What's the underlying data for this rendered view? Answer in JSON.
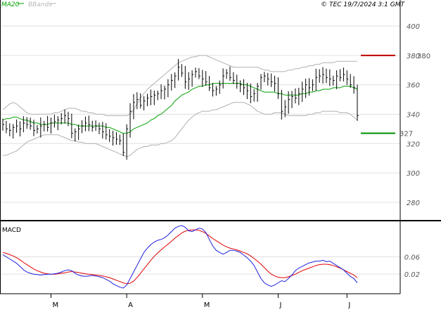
{
  "header": {
    "copyright": "© TEC 19/7/2024 3:1 GMT",
    "legend": [
      {
        "label": "MA20",
        "color": "#00a000"
      },
      {
        "label": "BBands",
        "color": "#b8b8b8"
      }
    ]
  },
  "panels": {
    "macd_label": "MACD"
  },
  "colors": {
    "price_bars": "#000000",
    "ma20": "#00a000",
    "bbands": "#b0b0b0",
    "resistance": "#c00000",
    "support": "#009000",
    "macd_line": "#2020e0",
    "signal_line": "#e00000",
    "grid": "#e0e0e0",
    "frame": "#000000"
  },
  "chart_data": [
    {
      "type": "ohlc",
      "ylim": [
        268,
        412
      ],
      "ytick_labels": [
        "400",
        "380",
        "360",
        "340",
        "320",
        "300",
        "280"
      ],
      "yticks": [
        400,
        380,
        360,
        340,
        320,
        300,
        280
      ],
      "xtick_labels": [
        "M",
        "A",
        "M",
        "J",
        "J"
      ],
      "xtick_index": [
        14,
        36,
        58,
        80,
        100
      ],
      "levels": [
        {
          "name": "resistance",
          "value": 380,
          "label": "380"
        },
        {
          "name": "support",
          "value": 327,
          "label": "327"
        }
      ],
      "closes": [
        333,
        330,
        329,
        331,
        332,
        330,
        334,
        333,
        332,
        329,
        330,
        332,
        333,
        331,
        334,
        335,
        336,
        337,
        339,
        337,
        327,
        328,
        330,
        332,
        334,
        333,
        331,
        332,
        330,
        328,
        326,
        325,
        324,
        323,
        322,
        314,
        330,
        342,
        348,
        350,
        346,
        349,
        351,
        352,
        353,
        354,
        356,
        357,
        360,
        363,
        366,
        372,
        368,
        362,
        364,
        367,
        369,
        366,
        364,
        362,
        358,
        356,
        357,
        360,
        366,
        368,
        365,
        363,
        361,
        360,
        358,
        356,
        352,
        354,
        359,
        365,
        366,
        364,
        362,
        361,
        354,
        342,
        345,
        350,
        352,
        351,
        354,
        357,
        360,
        358,
        360,
        365,
        366,
        367,
        365,
        364,
        363,
        366,
        365,
        367,
        364,
        360,
        358,
        339
      ],
      "ma20": [
        336,
        337,
        337,
        338,
        338,
        337,
        336,
        336,
        335,
        334,
        334,
        333,
        333,
        333,
        334,
        334,
        334,
        334,
        334,
        334,
        333,
        333,
        332,
        332,
        332,
        332,
        332,
        332,
        332,
        332,
        331,
        331,
        330,
        329,
        328,
        327,
        327,
        328,
        330,
        331,
        332,
        333,
        334,
        336,
        337,
        339,
        340,
        342,
        344,
        346,
        349,
        351,
        353,
        354,
        355,
        357,
        358,
        359,
        359,
        360,
        360,
        361,
        361,
        361,
        361,
        361,
        361,
        361,
        361,
        361,
        360,
        360,
        359,
        358,
        357,
        356,
        355,
        355,
        355,
        355,
        354,
        354,
        353,
        353,
        353,
        353,
        353,
        354,
        354,
        355,
        355,
        356,
        356,
        357,
        357,
        357,
        358,
        358,
        358,
        359,
        359,
        359,
        358,
        357
      ],
      "bb_upper": [
        343,
        345,
        347,
        348,
        347,
        345,
        343,
        341,
        340,
        340,
        340,
        340,
        340,
        340,
        340,
        341,
        341,
        342,
        343,
        344,
        344,
        344,
        343,
        342,
        342,
        341,
        341,
        340,
        340,
        340,
        339,
        339,
        339,
        339,
        339,
        339,
        339,
        340,
        343,
        347,
        351,
        354,
        357,
        359,
        361,
        363,
        365,
        367,
        369,
        371,
        373,
        375,
        376,
        377,
        378,
        379,
        379,
        380,
        380,
        380,
        379,
        378,
        377,
        376,
        375,
        374,
        373,
        372,
        372,
        372,
        372,
        372,
        372,
        372,
        372,
        371,
        370,
        370,
        369,
        369,
        369,
        369,
        369,
        370,
        370,
        371,
        371,
        372,
        372,
        373,
        373,
        374,
        374,
        375,
        375,
        375,
        375,
        376,
        376,
        376,
        376,
        376,
        376,
        376
      ],
      "bb_lower": [
        312,
        312,
        313,
        314,
        315,
        317,
        319,
        321,
        322,
        323,
        324,
        325,
        326,
        326,
        326,
        326,
        326,
        325,
        324,
        323,
        322,
        322,
        321,
        321,
        320,
        320,
        320,
        320,
        319,
        318,
        317,
        316,
        315,
        314,
        313,
        312,
        311,
        312,
        314,
        316,
        317,
        318,
        318,
        319,
        319,
        319,
        320,
        320,
        321,
        322,
        324,
        327,
        330,
        333,
        336,
        338,
        340,
        341,
        342,
        342,
        342,
        343,
        343,
        344,
        345,
        346,
        347,
        348,
        348,
        348,
        348,
        347,
        346,
        344,
        342,
        341,
        340,
        340,
        340,
        341,
        341,
        341,
        340,
        339,
        339,
        339,
        339,
        339,
        339,
        340,
        340,
        341,
        341,
        342,
        342,
        342,
        342,
        342,
        341,
        341,
        341,
        340,
        338,
        336
      ],
      "macd": [
        0.065,
        0.06,
        0.055,
        0.05,
        0.045,
        0.038,
        0.03,
        0.025,
        0.022,
        0.02,
        0.019,
        0.018,
        0.019,
        0.02,
        0.02,
        0.021,
        0.022,
        0.025,
        0.028,
        0.03,
        0.028,
        0.022,
        0.018,
        0.016,
        0.015,
        0.016,
        0.017,
        0.016,
        0.014,
        0.012,
        0.008,
        0.004,
        -0.002,
        -0.006,
        -0.01,
        -0.012,
        -0.005,
        0.01,
        0.025,
        0.04,
        0.055,
        0.07,
        0.08,
        0.088,
        0.094,
        0.098,
        0.1,
        0.104,
        0.11,
        0.118,
        0.126,
        0.13,
        0.132,
        0.128,
        0.12,
        0.118,
        0.122,
        0.126,
        0.124,
        0.116,
        0.1,
        0.085,
        0.075,
        0.07,
        0.066,
        0.07,
        0.075,
        0.075,
        0.073,
        0.07,
        0.064,
        0.058,
        0.05,
        0.04,
        0.025,
        0.01,
        0.0,
        -0.005,
        -0.008,
        -0.005,
        0.0,
        0.005,
        0.003,
        0.01,
        0.018,
        0.028,
        0.034,
        0.038,
        0.042,
        0.046,
        0.048,
        0.05,
        0.05,
        0.052,
        0.049,
        0.05,
        0.045,
        0.04,
        0.035,
        0.03,
        0.022,
        0.015,
        0.01,
        0.0
      ],
      "signal": [
        0.07,
        0.068,
        0.065,
        0.062,
        0.058,
        0.053,
        0.047,
        0.042,
        0.037,
        0.032,
        0.028,
        0.025,
        0.022,
        0.021,
        0.02,
        0.02,
        0.021,
        0.022,
        0.023,
        0.025,
        0.026,
        0.025,
        0.024,
        0.022,
        0.021,
        0.02,
        0.019,
        0.018,
        0.017,
        0.016,
        0.014,
        0.012,
        0.009,
        0.006,
        0.003,
        0.0,
        -0.002,
        -0.001,
        0.004,
        0.012,
        0.022,
        0.032,
        0.042,
        0.052,
        0.061,
        0.069,
        0.076,
        0.083,
        0.089,
        0.096,
        0.103,
        0.109,
        0.115,
        0.119,
        0.121,
        0.122,
        0.122,
        0.121,
        0.118,
        0.114,
        0.108,
        0.102,
        0.097,
        0.092,
        0.087,
        0.083,
        0.08,
        0.078,
        0.076,
        0.073,
        0.07,
        0.067,
        0.062,
        0.056,
        0.05,
        0.043,
        0.035,
        0.027,
        0.02,
        0.016,
        0.013,
        0.012,
        0.012,
        0.014,
        0.017,
        0.02,
        0.024,
        0.028,
        0.031,
        0.034,
        0.037,
        0.04,
        0.042,
        0.043,
        0.043,
        0.042,
        0.04,
        0.037,
        0.034,
        0.03,
        0.026,
        0.022,
        0.018,
        0.012
      ],
      "macd_ylim": [
        -0.025,
        0.14
      ],
      "macd_ytick_labels": [
        "0.06",
        "0.02"
      ],
      "macd_yticks": [
        0.06,
        0.02
      ]
    }
  ]
}
